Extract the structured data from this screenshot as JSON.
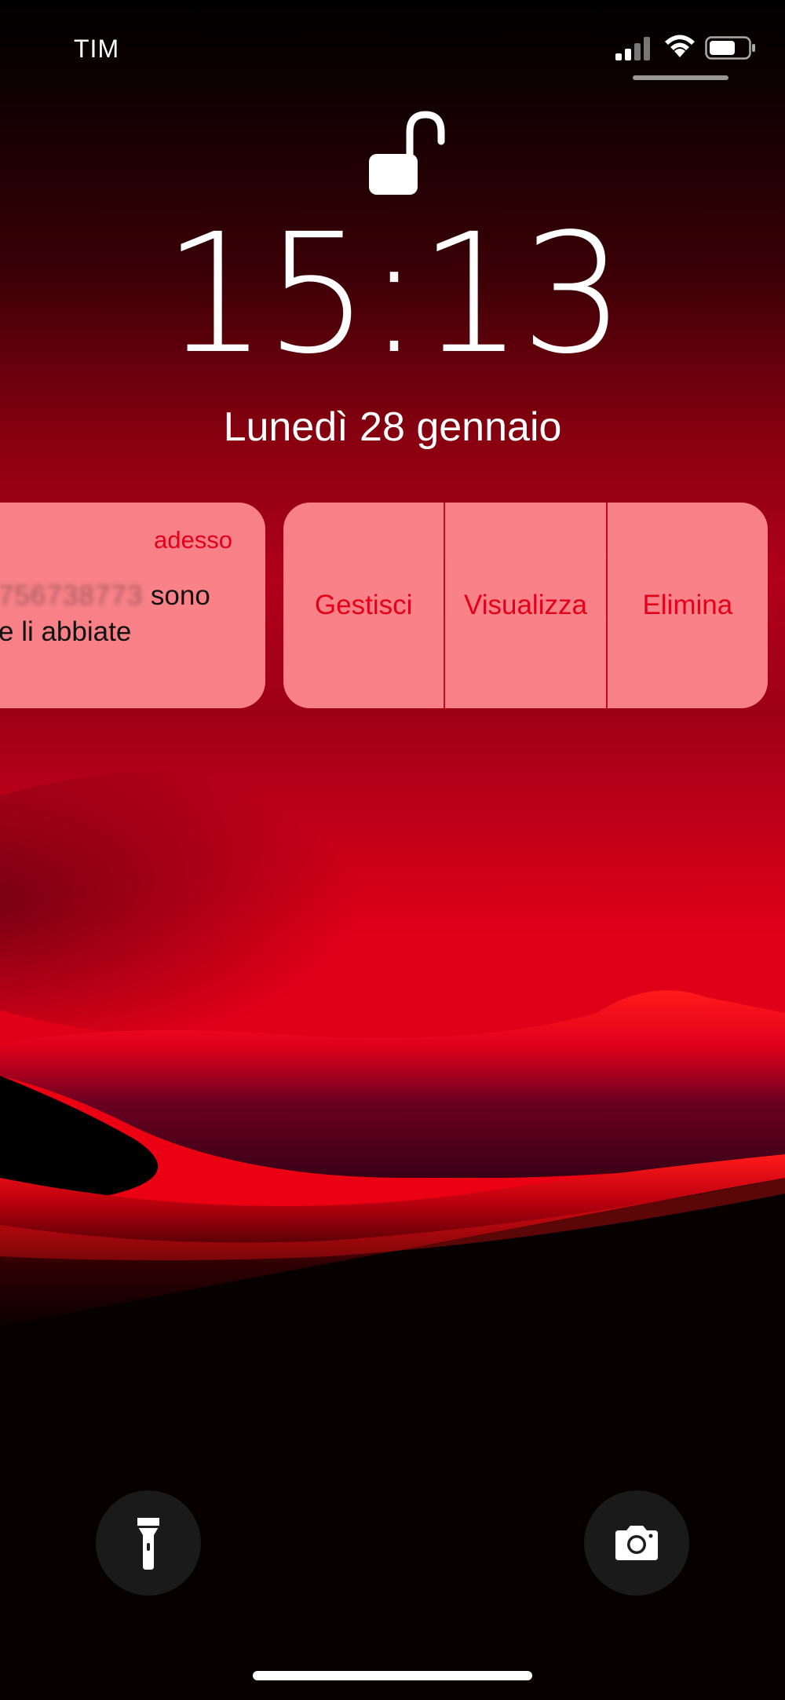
{
  "status_bar": {
    "carrier": "TIM",
    "icons": [
      "signal-icon",
      "wifi-icon",
      "battery-icon"
    ]
  },
  "lock_screen": {
    "lock_icon": "unlocked-padlock-icon",
    "time": "15:13",
    "date": "Lunedì 28 gennaio"
  },
  "notification": {
    "time": "adesso",
    "body_line1_hidden": "756738773",
    "body_line1_text": " sono",
    "body_line2": "e li abbiate",
    "actions": [
      {
        "label": "Gestisci"
      },
      {
        "label": "Visualizza"
      },
      {
        "label": "Elimina"
      }
    ]
  },
  "bottom_controls": {
    "flashlight_icon": "flashlight-icon",
    "camera_icon": "camera-icon"
  },
  "colors": {
    "accent": "#e3001b",
    "card": "#ff8c91"
  }
}
